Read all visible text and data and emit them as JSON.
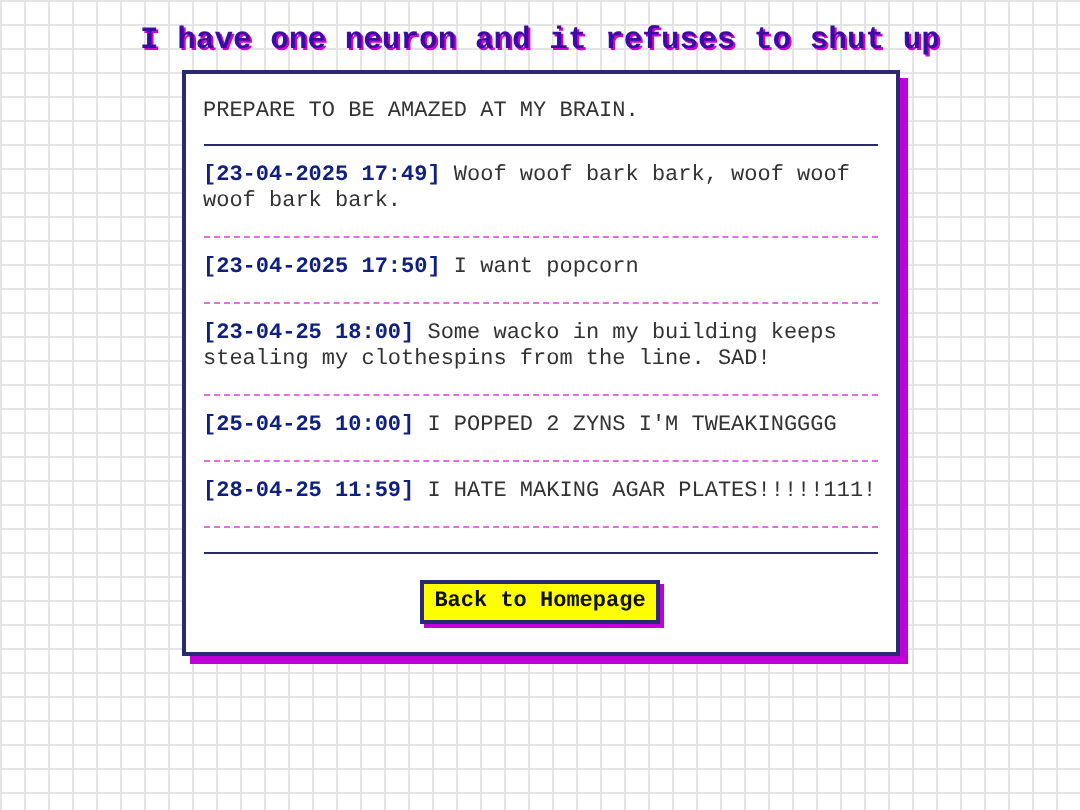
{
  "title": "I have one neuron and it refuses to shut up",
  "intro": "PREPARE TO BE AMAZED AT MY BRAIN.",
  "entries": [
    {
      "text": "**[23-04-2025 17:49]** Woof woof bark bark, woof woof woof bark bark."
    },
    {
      "text": "**[23-04-2025 17:50]** I want popcorn"
    },
    {
      "text": "**[23-04-25 18:00]** Some wacko in my building keeps stealing my clothespins from the line. SAD!"
    },
    {
      "text": "**[25-04-25 10:00]** I POPPED 2 ZYNS I'M TWEAKINGGGG"
    },
    {
      "text": "**[28-04-25 11:59]** I HATE MAKING AGAR PLATES!!!!!111!"
    }
  ],
  "button": "Back to Homepage"
}
